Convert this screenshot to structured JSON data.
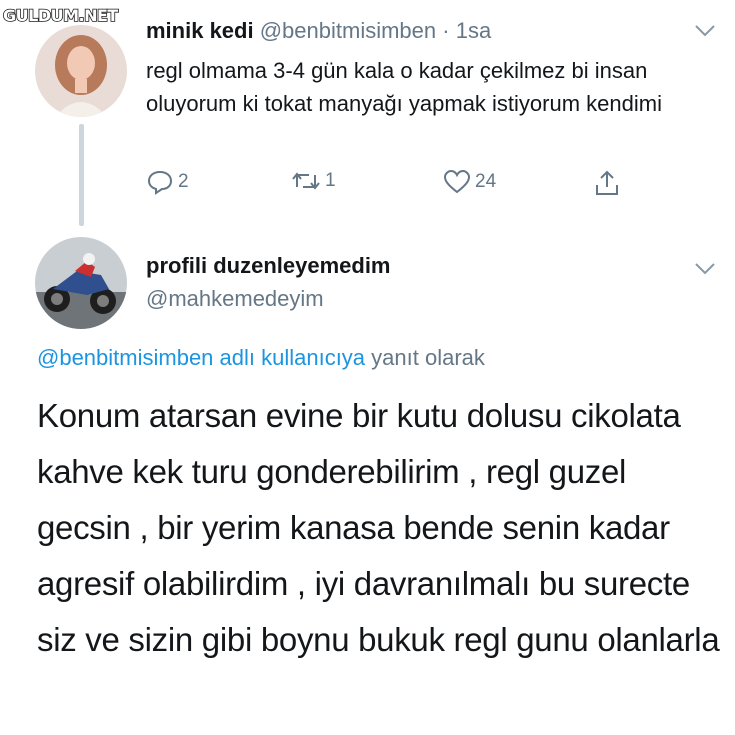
{
  "watermark": {
    "text": "GULDUM.NET"
  },
  "tweet1": {
    "author_name": "minik kedi",
    "author_handle": "@benbitmisimben",
    "separator": "·",
    "time": "1sa",
    "text": "regl olmama 3-4 gün kala o kadar çekilmez bi insan oluyorum ki tokat manyağı yapmak istiyorum kendimi",
    "reply_count": "2",
    "retweet_count": "1",
    "like_count": "24"
  },
  "tweet2": {
    "author_name": "profili duzenleyemedim",
    "author_handle": "@mahkemedeyim",
    "reply_to_handle": "@benbitmisimben adlı kullanıcıya",
    "reply_to_suffix": "yanıt olarak",
    "text": "Konum atarsan evine bir kutu dolusu cikolata kahve kek turu gonderebilirim , regl guzel gecsin , bir yerim kanasa bende senin kadar agresif olabilirdim , iyi davranılmalı bu surecte siz ve sizin gibi boynu bukuk regl gunu olanlarla"
  },
  "icons": {
    "reply": "reply-icon",
    "retweet": "retweet-icon",
    "like": "heart-icon",
    "share": "share-icon",
    "more": "chevron-down-icon"
  },
  "colors": {
    "text": "#14171a",
    "secondary": "#657786",
    "link": "#1b95e0",
    "thread_line": "#cdd6dd"
  }
}
